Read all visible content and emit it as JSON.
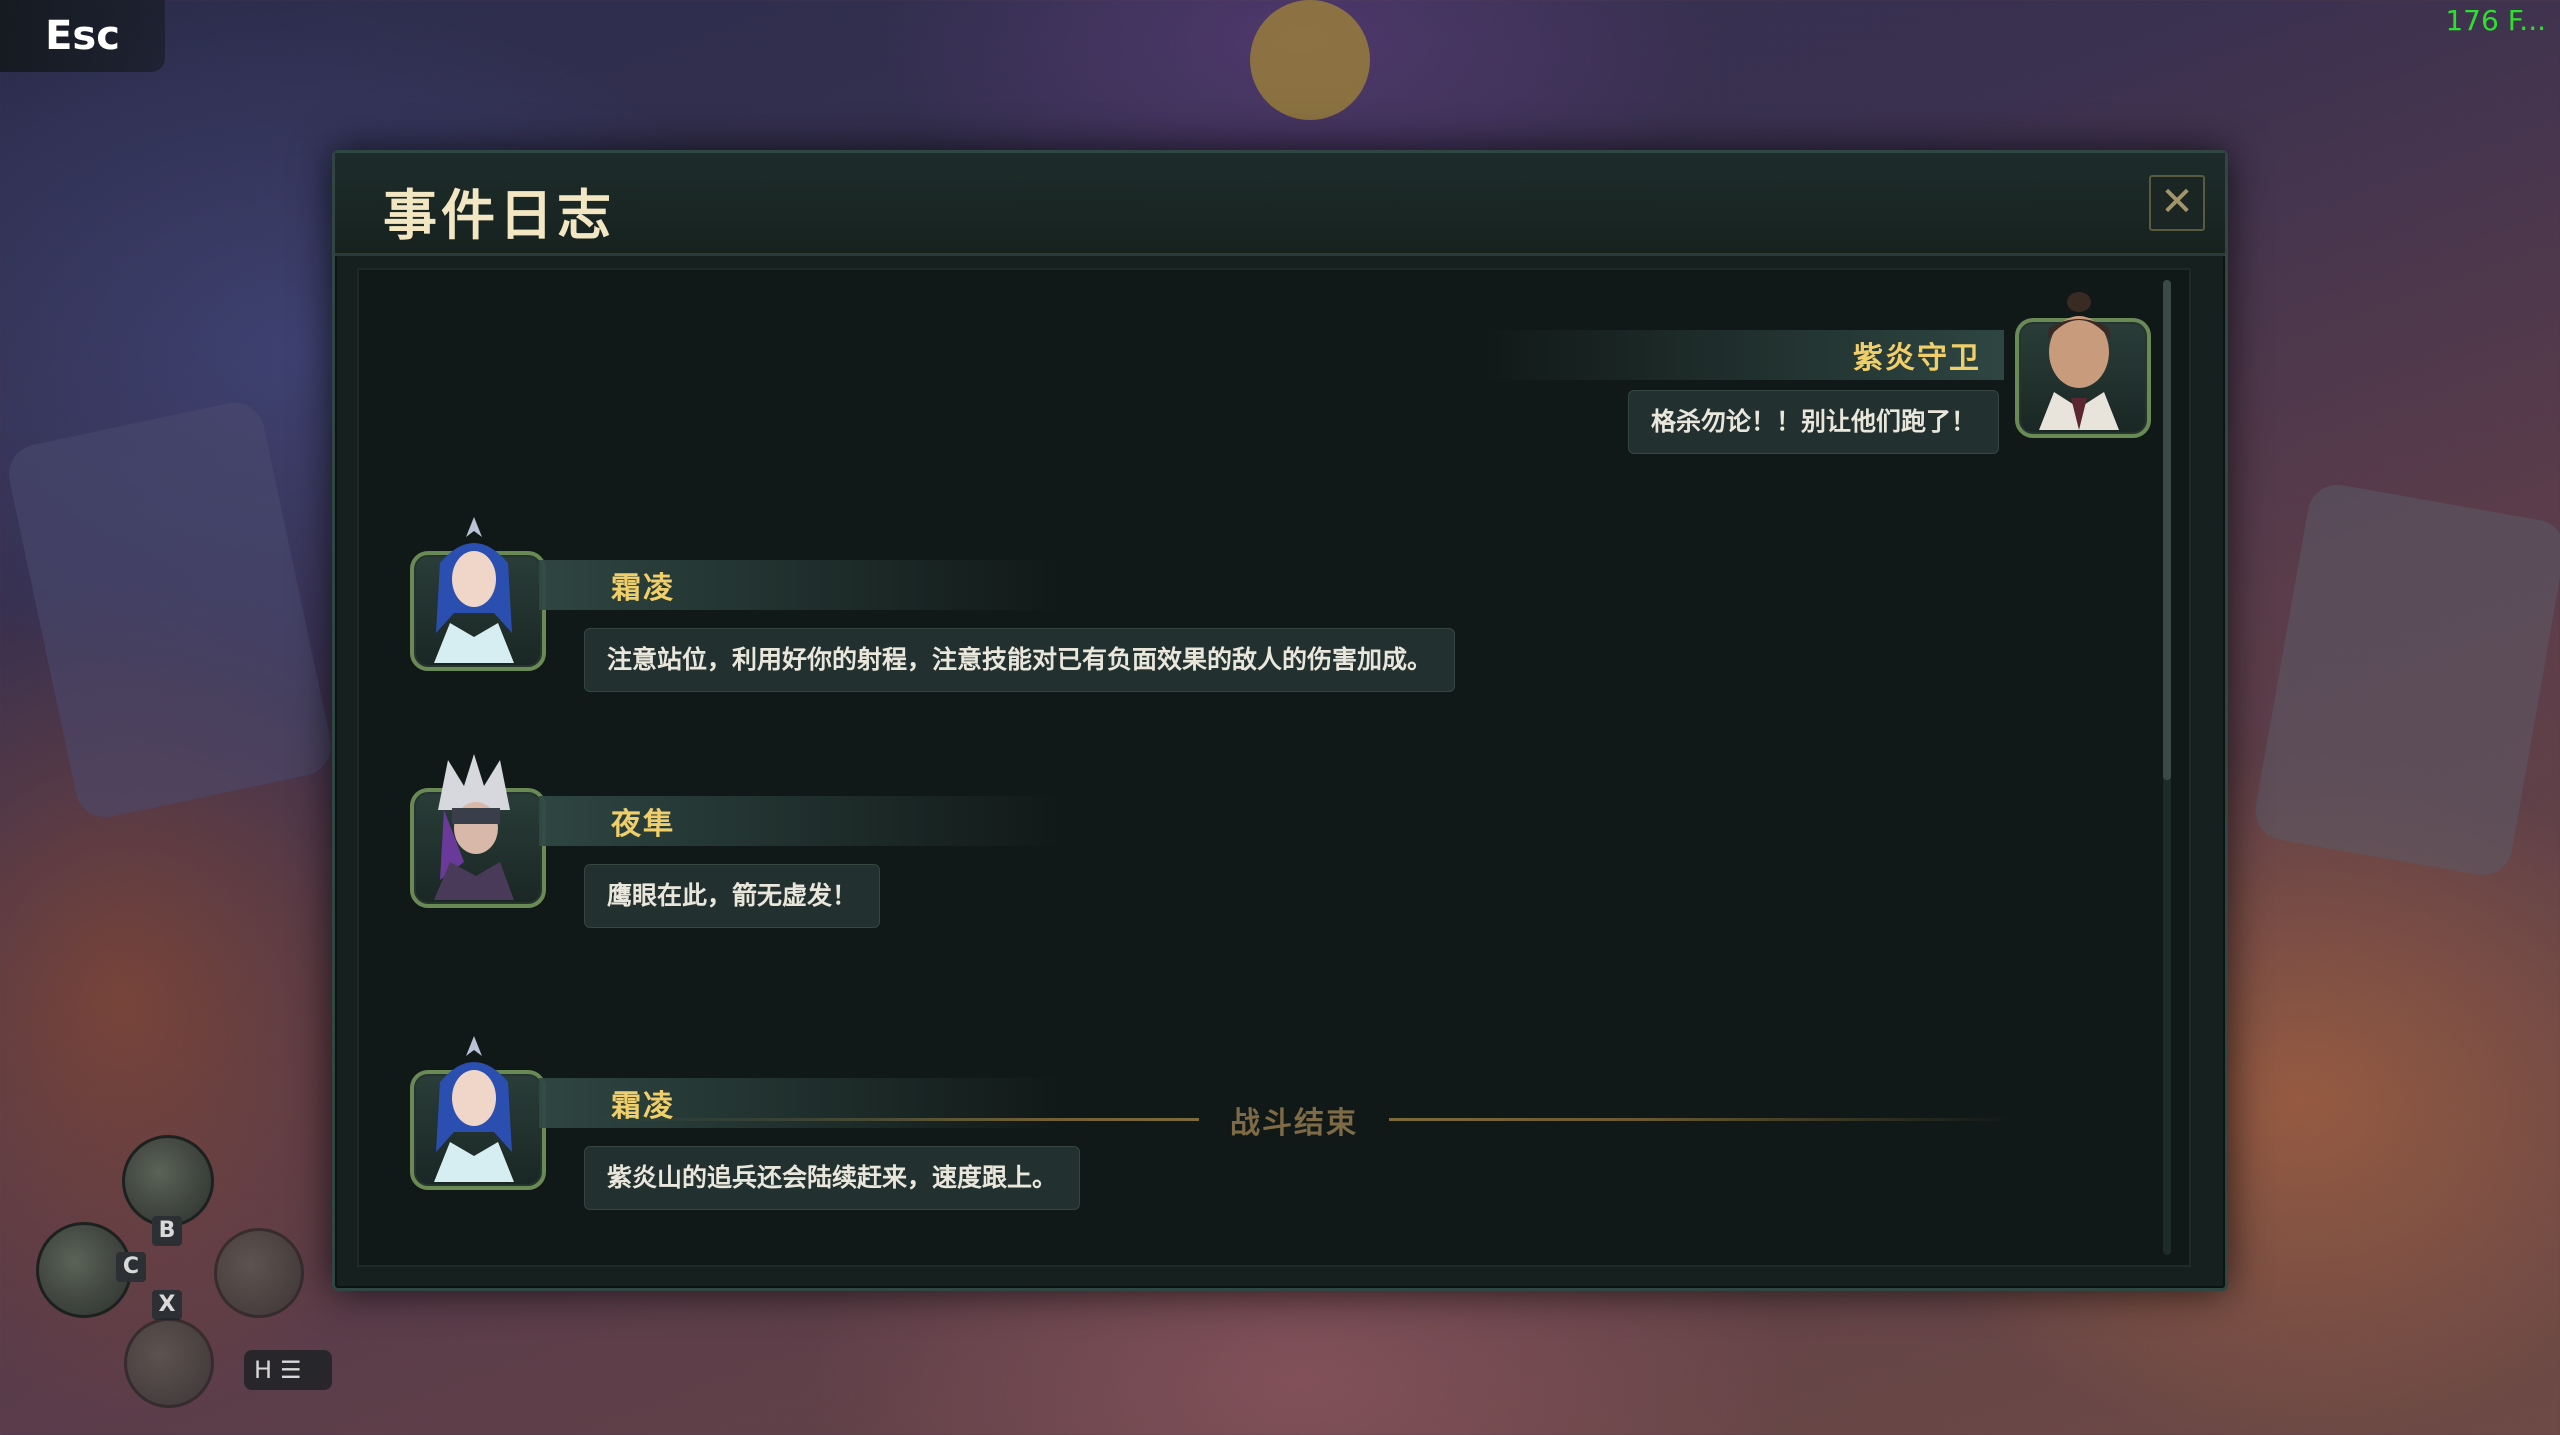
{
  "hud": {
    "esc_label": "Esc",
    "fps_text": "176 F...",
    "key_b": "B",
    "key_c": "C",
    "key_x": "X",
    "key_h": "H"
  },
  "panel": {
    "title": "事件日志",
    "close_icon": "close-icon"
  },
  "log": {
    "entries": [
      {
        "speaker": "紫炎守卫",
        "text": "格杀勿论！！别让他们跑了！",
        "side": "right",
        "avatar": "male-guard-portrait"
      },
      {
        "speaker": "霜凌",
        "text": "注意站位，利用好你的射程，注意技能对已有负面效果的敌人的伤害加成。",
        "side": "left",
        "avatar": "blue-hair-woman-portrait"
      },
      {
        "speaker": "夜隼",
        "text": "鹰眼在此，箭无虚发！",
        "side": "left",
        "avatar": "masked-archer-portrait"
      },
      {
        "speaker": "霜凌",
        "text": "紫炎山的追兵还会陆续赶来，速度跟上。",
        "side": "left",
        "avatar": "blue-hair-woman-portrait"
      }
    ],
    "divider_label": "战斗结束"
  },
  "colors": {
    "name_gold": "#f0cf6a",
    "panel_bg": "#15201f",
    "fps_green": "#2ee02e"
  }
}
